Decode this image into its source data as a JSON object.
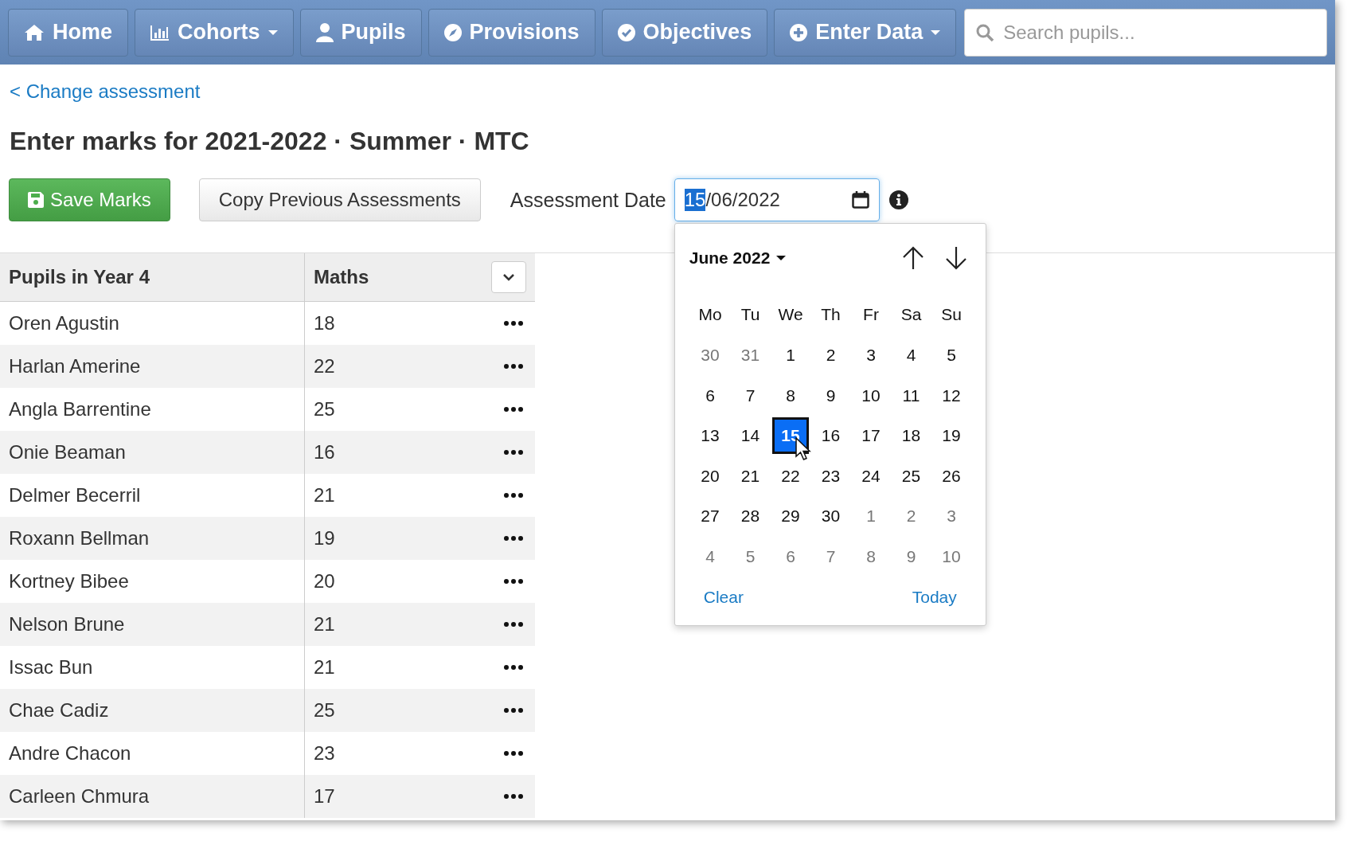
{
  "nav": {
    "items": [
      {
        "label": "Home",
        "has_menu": false
      },
      {
        "label": "Cohorts",
        "has_menu": true
      },
      {
        "label": "Pupils",
        "has_menu": false
      },
      {
        "label": "Provisions",
        "has_menu": false
      },
      {
        "label": "Objectives",
        "has_menu": false
      },
      {
        "label": "Enter Data",
        "has_menu": true
      }
    ],
    "search": {
      "placeholder": "Search pupils..."
    }
  },
  "back_link": "< Change assessment",
  "heading": "Enter marks for 2021-2022 · Summer · MTC",
  "actions": {
    "save": "Save Marks",
    "copy": "Copy Previous Assessments",
    "date_label": "Assessment Date",
    "date_field": {
      "segments": [
        {
          "text": "15",
          "selected": true
        },
        {
          "text": "/06/2022",
          "selected": false
        }
      ]
    }
  },
  "table": {
    "columns": [
      "Pupils in Year 4",
      "Maths"
    ],
    "rows": [
      {
        "name": "Oren Agustin",
        "mark": "18"
      },
      {
        "name": "Harlan Amerine",
        "mark": "22"
      },
      {
        "name": "Angla Barrentine",
        "mark": "25"
      },
      {
        "name": "Onie Beaman",
        "mark": "16"
      },
      {
        "name": "Delmer Becerril",
        "mark": "21"
      },
      {
        "name": "Roxann Bellman",
        "mark": "19"
      },
      {
        "name": "Kortney Bibee",
        "mark": "20"
      },
      {
        "name": "Nelson Brune",
        "mark": "21"
      },
      {
        "name": "Issac Bun",
        "mark": "21"
      },
      {
        "name": "Chae Cadiz",
        "mark": "25"
      },
      {
        "name": "Andre Chacon",
        "mark": "23"
      },
      {
        "name": "Carleen Chmura",
        "mark": "17"
      }
    ]
  },
  "calendar": {
    "month": "June 2022",
    "weekdays": [
      "Mo",
      "Tu",
      "We",
      "Th",
      "Fr",
      "Sa",
      "Su"
    ],
    "days": [
      {
        "label": "30",
        "muted": true,
        "selected": false
      },
      {
        "label": "31",
        "muted": true,
        "selected": false
      },
      {
        "label": "1",
        "muted": false,
        "selected": false
      },
      {
        "label": "2",
        "muted": false,
        "selected": false
      },
      {
        "label": "3",
        "muted": false,
        "selected": false
      },
      {
        "label": "4",
        "muted": false,
        "selected": false
      },
      {
        "label": "5",
        "muted": false,
        "selected": false
      },
      {
        "label": "6",
        "muted": false,
        "selected": false
      },
      {
        "label": "7",
        "muted": false,
        "selected": false
      },
      {
        "label": "8",
        "muted": false,
        "selected": false
      },
      {
        "label": "9",
        "muted": false,
        "selected": false
      },
      {
        "label": "10",
        "muted": false,
        "selected": false
      },
      {
        "label": "11",
        "muted": false,
        "selected": false
      },
      {
        "label": "12",
        "muted": false,
        "selected": false
      },
      {
        "label": "13",
        "muted": false,
        "selected": false
      },
      {
        "label": "14",
        "muted": false,
        "selected": false
      },
      {
        "label": "15",
        "muted": false,
        "selected": true
      },
      {
        "label": "16",
        "muted": false,
        "selected": false
      },
      {
        "label": "17",
        "muted": false,
        "selected": false
      },
      {
        "label": "18",
        "muted": false,
        "selected": false
      },
      {
        "label": "19",
        "muted": false,
        "selected": false
      },
      {
        "label": "20",
        "muted": false,
        "selected": false
      },
      {
        "label": "21",
        "muted": false,
        "selected": false
      },
      {
        "label": "22",
        "muted": false,
        "selected": false
      },
      {
        "label": "23",
        "muted": false,
        "selected": false
      },
      {
        "label": "24",
        "muted": false,
        "selected": false
      },
      {
        "label": "25",
        "muted": false,
        "selected": false
      },
      {
        "label": "26",
        "muted": false,
        "selected": false
      },
      {
        "label": "27",
        "muted": false,
        "selected": false
      },
      {
        "label": "28",
        "muted": false,
        "selected": false
      },
      {
        "label": "29",
        "muted": false,
        "selected": false
      },
      {
        "label": "30",
        "muted": false,
        "selected": false
      },
      {
        "label": "1",
        "muted": true,
        "selected": false
      },
      {
        "label": "2",
        "muted": true,
        "selected": false
      },
      {
        "label": "3",
        "muted": true,
        "selected": false
      },
      {
        "label": "4",
        "muted": true,
        "selected": false
      },
      {
        "label": "5",
        "muted": true,
        "selected": false
      },
      {
        "label": "6",
        "muted": true,
        "selected": false
      },
      {
        "label": "7",
        "muted": true,
        "selected": false
      },
      {
        "label": "8",
        "muted": true,
        "selected": false
      },
      {
        "label": "9",
        "muted": true,
        "selected": false
      },
      {
        "label": "10",
        "muted": true,
        "selected": false
      }
    ],
    "clear": "Clear",
    "today": "Today"
  }
}
